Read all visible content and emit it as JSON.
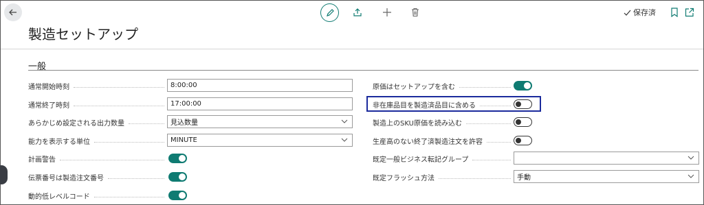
{
  "header": {
    "saved_label": "保存済",
    "page_title": "製造セットアップ"
  },
  "section": {
    "title": "一般"
  },
  "left_fields": [
    {
      "label": "通常開始時刻",
      "type": "text",
      "value": "8:00:00"
    },
    {
      "label": "通常終了時刻",
      "type": "text",
      "value": "17:00:00"
    },
    {
      "label": "あらかじめ設定される出力数量",
      "type": "select",
      "value": "見込数量"
    },
    {
      "label": "能力を表示する単位",
      "type": "select",
      "value": "MINUTE"
    },
    {
      "label": "計画警告",
      "type": "toggle",
      "on": true
    },
    {
      "label": "伝票番号は製造注文番号",
      "type": "toggle",
      "on": true
    },
    {
      "label": "動的低レベルコード",
      "type": "toggle",
      "on": true
    }
  ],
  "right_fields": [
    {
      "label": "原価はセットアップを含む",
      "type": "toggle",
      "on": true
    },
    {
      "label": "非在庫品目を製造済品目に含める",
      "type": "toggle",
      "on": false
    },
    {
      "label": "製造上のSKU原価を読み込む",
      "type": "toggle",
      "on": false
    },
    {
      "label": "生産高のない終了済製造注文を許容",
      "type": "toggle",
      "on": false
    },
    {
      "label": "既定一般ビジネス転記グループ",
      "type": "select",
      "value": ""
    },
    {
      "label": "既定フラッシュ方法",
      "type": "select",
      "value": "手動"
    }
  ],
  "colors": {
    "accent": "#0f7b72",
    "highlight": "#1a2a9c"
  }
}
